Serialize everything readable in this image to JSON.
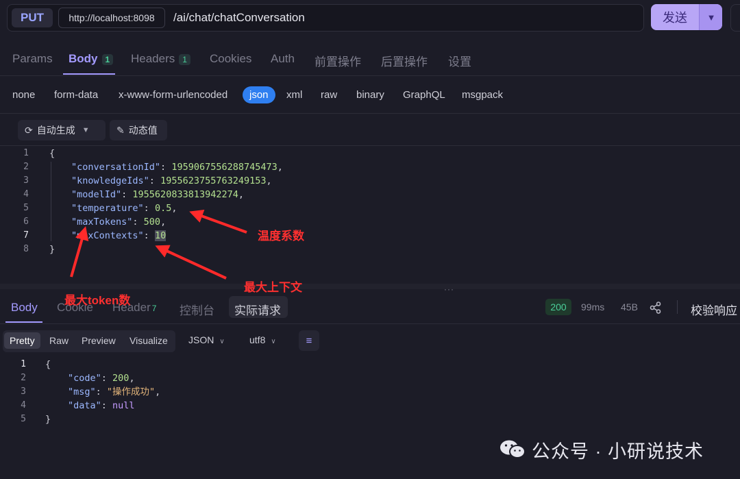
{
  "request": {
    "method": "PUT",
    "host": "http://localhost:8098",
    "path": "/ai/chat/chatConversation",
    "send_label": "发送"
  },
  "request_tabs": [
    {
      "label": "Params",
      "badge": ""
    },
    {
      "label": "Body",
      "badge": "1"
    },
    {
      "label": "Headers",
      "badge": "1"
    },
    {
      "label": "Cookies",
      "badge": ""
    },
    {
      "label": "Auth",
      "badge": ""
    },
    {
      "label": "前置操作",
      "badge": ""
    },
    {
      "label": "后置操作",
      "badge": ""
    },
    {
      "label": "设置",
      "badge": ""
    }
  ],
  "body_types": [
    "none",
    "form-data",
    "x-www-form-urlencoded",
    "json",
    "xml",
    "raw",
    "binary",
    "GraphQL",
    "msgpack"
  ],
  "body_type_selected": "json",
  "editor_toolbar": {
    "auto_generate": "自动生成",
    "dynamic_value": "动态值"
  },
  "request_body": {
    "line_numbers": [
      "1",
      "2",
      "3",
      "4",
      "5",
      "6",
      "7",
      "8"
    ],
    "open": "{",
    "close": "}",
    "fields": [
      {
        "key": "\"conversationId\"",
        "value": "1959067556288745473",
        "comma": ","
      },
      {
        "key": "\"knowledgeIds\"",
        "value": "1955623755763249153",
        "comma": ","
      },
      {
        "key": "\"modelId\"",
        "value": "1955620833813942274",
        "comma": ","
      },
      {
        "key": "\"temperature\"",
        "value": "0.5",
        "comma": ","
      },
      {
        "key": "\"maxTokens\"",
        "value": "500",
        "comma": ","
      },
      {
        "key": "\"maxContexts\"",
        "value": "10",
        "comma": ""
      }
    ]
  },
  "annotations": {
    "temperature": "温度系数",
    "max_context": "最大上下文",
    "max_token": "最大token数"
  },
  "response_tabs": [
    {
      "label": "Body",
      "badge": ""
    },
    {
      "label": "Cookie",
      "badge": ""
    },
    {
      "label": "Header",
      "badge": "7"
    },
    {
      "label": "控制台",
      "badge": ""
    },
    {
      "label": "实际请求",
      "badge": ""
    }
  ],
  "response_meta": {
    "status": "200",
    "time": "99ms",
    "size": "45B",
    "verify": "校验响应"
  },
  "view_modes": [
    "Pretty",
    "Raw",
    "Preview",
    "Visualize"
  ],
  "format": "JSON",
  "encoding": "utf8",
  "response_body": {
    "line_numbers": [
      "1",
      "2",
      "3",
      "4",
      "5"
    ],
    "open": "{",
    "close": "}",
    "fields": [
      {
        "key": "\"code\"",
        "value": "200",
        "comma": ","
      },
      {
        "key": "\"msg\"",
        "value": "\"操作成功\"",
        "comma": ","
      },
      {
        "key": "\"data\"",
        "value": "null",
        "comma": ""
      }
    ]
  },
  "watermark": "公众号 · 小研说技术",
  "colors": {
    "accent": "#a49bff",
    "send": "#b8a6f6",
    "selected_body_type": "#2f7ff0",
    "status_ok": "#4bd09a",
    "annotation": "#ff3030"
  }
}
